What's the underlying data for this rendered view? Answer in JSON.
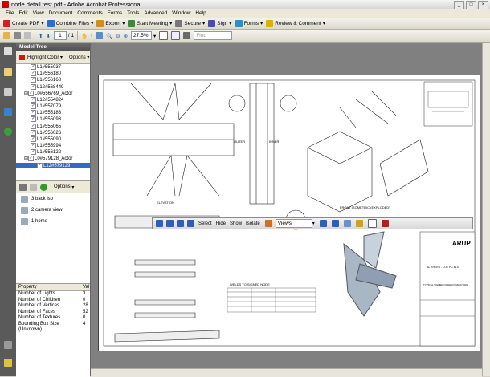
{
  "window": {
    "title": "node detail test.pdf - Adobe Acrobat Professional"
  },
  "menu": [
    "File",
    "Edit",
    "View",
    "Document",
    "Comments",
    "Forms",
    "Tools",
    "Advanced",
    "Window",
    "Help"
  ],
  "toolbar1": {
    "create_pdf": "Create PDF",
    "combine": "Combine Files",
    "export": "Export",
    "meeting": "Start Meeting",
    "secure": "Secure",
    "sign": "Sign",
    "forms": "Forms",
    "review": "Review & Comment"
  },
  "toolbar2": {
    "page_current": "1",
    "page_total": "/ 1",
    "zoom": "27.5%",
    "find_placeholder": "Find"
  },
  "panel": {
    "title": "Model Tree",
    "highlight_label": "Highlight Color",
    "options_label": "Options"
  },
  "tree_items": [
    "L1#555037",
    "L1#556180",
    "L1#556168",
    "L12#568449",
    "L0#556769_Actor",
    "L12#554824",
    "L1#557079",
    "L1#555183",
    "L1#555093",
    "L1#555065",
    "L1#556026",
    "L1#555090",
    "L1#555994",
    "L1#556122",
    "L0#579128_Actor",
    "L12#579129"
  ],
  "views": {
    "options_label": "Options",
    "items": [
      "3 back iso",
      "2 camera view",
      "1 home"
    ]
  },
  "properties": {
    "col_property": "Property",
    "col_value": "Val",
    "rows": [
      {
        "k": "Number of Lights",
        "v": "3"
      },
      {
        "k": "Number of Children",
        "v": "0"
      },
      {
        "k": "Number of Vertices",
        "v": "28"
      },
      {
        "k": "Number of Faces",
        "v": "52"
      },
      {
        "k": "Number of Textures",
        "v": "0"
      },
      {
        "k": "Bounding Box Size (Unknown)",
        "v": "4"
      }
    ]
  },
  "tools3d": {
    "select": "Select",
    "hide": "Hide",
    "show": "Show",
    "isolate": "Isolate",
    "views": "Views"
  },
  "drawing": {
    "elevation": "ELEVATION",
    "front_iso": "FRONT ISOMETRIC (EXPLODED)",
    "outer": "OUTER",
    "inner": "INNER",
    "section": "SECTION",
    "detail": "DETAIL",
    "welds_title": "WELDS TO SIGNED NODE",
    "logo": "ARUP",
    "project": "AL KHEED - LOT PC 614",
    "typical": "TYPICAL SIGNED NODE CONNECTION"
  }
}
